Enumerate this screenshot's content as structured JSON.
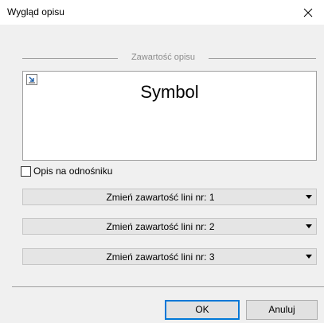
{
  "window": {
    "title": "Wygląd opisu",
    "close_icon": "close-icon"
  },
  "group": {
    "title": "Zawartość opisu"
  },
  "preview": {
    "icon": "expand-icon",
    "text": "Symbol"
  },
  "checkbox": {
    "label": "Opis na odnośniku",
    "checked": false
  },
  "dropdowns": [
    {
      "label": "Zmień zawartość lini nr: 1"
    },
    {
      "label": "Zmień zawartość lini nr: 2"
    },
    {
      "label": "Zmień zawartość lini nr: 3"
    }
  ],
  "buttons": {
    "ok": "OK",
    "cancel": "Anuluj"
  },
  "colors": {
    "accent": "#0078d7",
    "dialog_bg": "#f0f0f0"
  }
}
